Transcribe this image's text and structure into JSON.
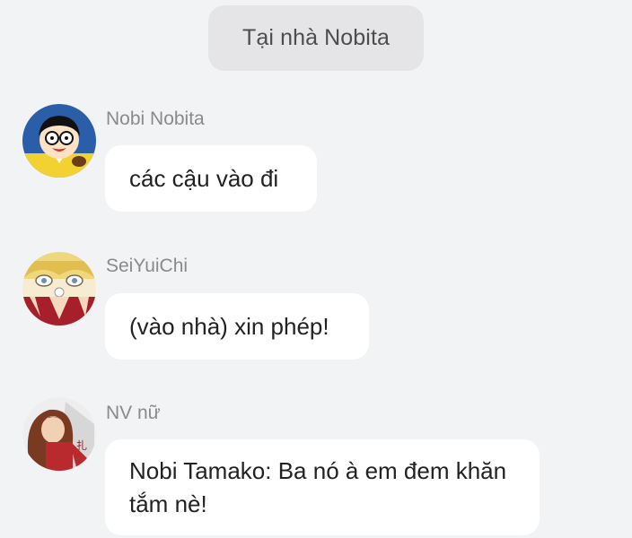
{
  "location": {
    "label": "Tại nhà Nobita"
  },
  "messages": [
    {
      "sender": "Nobi Nobita",
      "avatar": "nobita-avatar",
      "text": "các cậu vào đi"
    },
    {
      "sender": "SeiYuiChi",
      "avatar": "seiyuichi-avatar",
      "text": "(vào nhà) xin phép!"
    },
    {
      "sender": "NV nữ",
      "avatar": "nv-nu-avatar",
      "text": "Nobi Tamako: Ba nó à em đem khăn tắm nè!"
    }
  ],
  "colors": {
    "background": "#f2f3f5",
    "pill": "#e5e5e7",
    "bubble": "#ffffff",
    "name_text": "#8a8a8a"
  }
}
